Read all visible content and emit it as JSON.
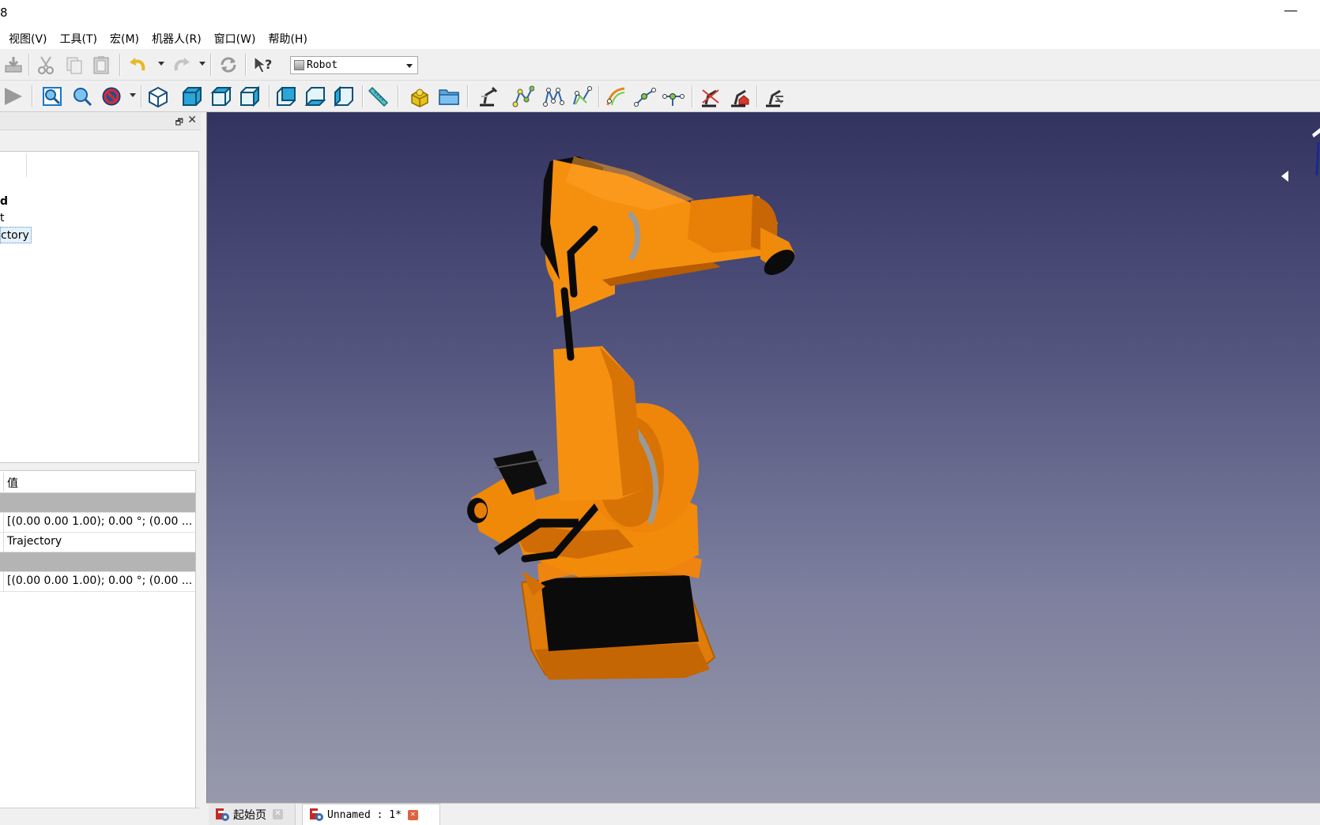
{
  "window": {
    "title": "8",
    "minimize_label": "—"
  },
  "menu": {
    "items": [
      "视图(V)",
      "工具(T)",
      "宏(M)",
      "机器人(R)",
      "窗口(W)",
      "帮助(H)"
    ]
  },
  "toolbar": {
    "workbench_selected": "Robot"
  },
  "combo_view": {
    "float_label": "🗗",
    "close_label": "✕",
    "tree_items": [
      "d",
      "t",
      "ctory"
    ]
  },
  "property_view": {
    "header_value": "值",
    "rows": [
      {
        "type": "group",
        "value": ""
      },
      {
        "type": "value",
        "value": "[(0.00 0.00 1.00); 0.00 °; (0.00 ..."
      },
      {
        "type": "value",
        "value": "Trajectory"
      },
      {
        "type": "group",
        "value": ""
      },
      {
        "type": "value",
        "value": "[(0.00 0.00 1.00); 0.00 °; (0.00 ..."
      }
    ]
  },
  "documents": {
    "tabs": [
      {
        "label": "起始页",
        "active": false
      },
      {
        "label": "Unnamed : 1*",
        "active": true
      }
    ],
    "close_glyph": "✕"
  },
  "colors": {
    "robot_orange": "#f28a0a",
    "robot_dark": "#c96a05",
    "bg_top": "#33335f",
    "bg_bottom": "#9899ab",
    "close_red": "#e0613f"
  },
  "icons": [
    "import-icon",
    "cut-icon",
    "copy-icon",
    "paste-icon",
    "undo-icon",
    "redo-icon",
    "refresh-icon",
    "whats-this-icon",
    "play-macro-icon",
    "fit-all-icon",
    "fit-selection-icon",
    "draw-style-icon",
    "isometric-view-icon",
    "front-view-icon",
    "top-view-icon",
    "right-view-icon",
    "rear-view-icon",
    "bottom-view-icon",
    "left-view-icon",
    "measure-icon",
    "part-icon",
    "open-folder-icon",
    "robot-simulate-icon",
    "trajectory-icon",
    "trajectory-compound-icon",
    "trajectory-dressup-icon",
    "edge-to-trajectory-icon",
    "insert-waypoint-icon",
    "insert-waypoint-preselect-icon",
    "robot-kuka-export-icon",
    "robot-home-icon",
    "robot-tool-icon"
  ]
}
